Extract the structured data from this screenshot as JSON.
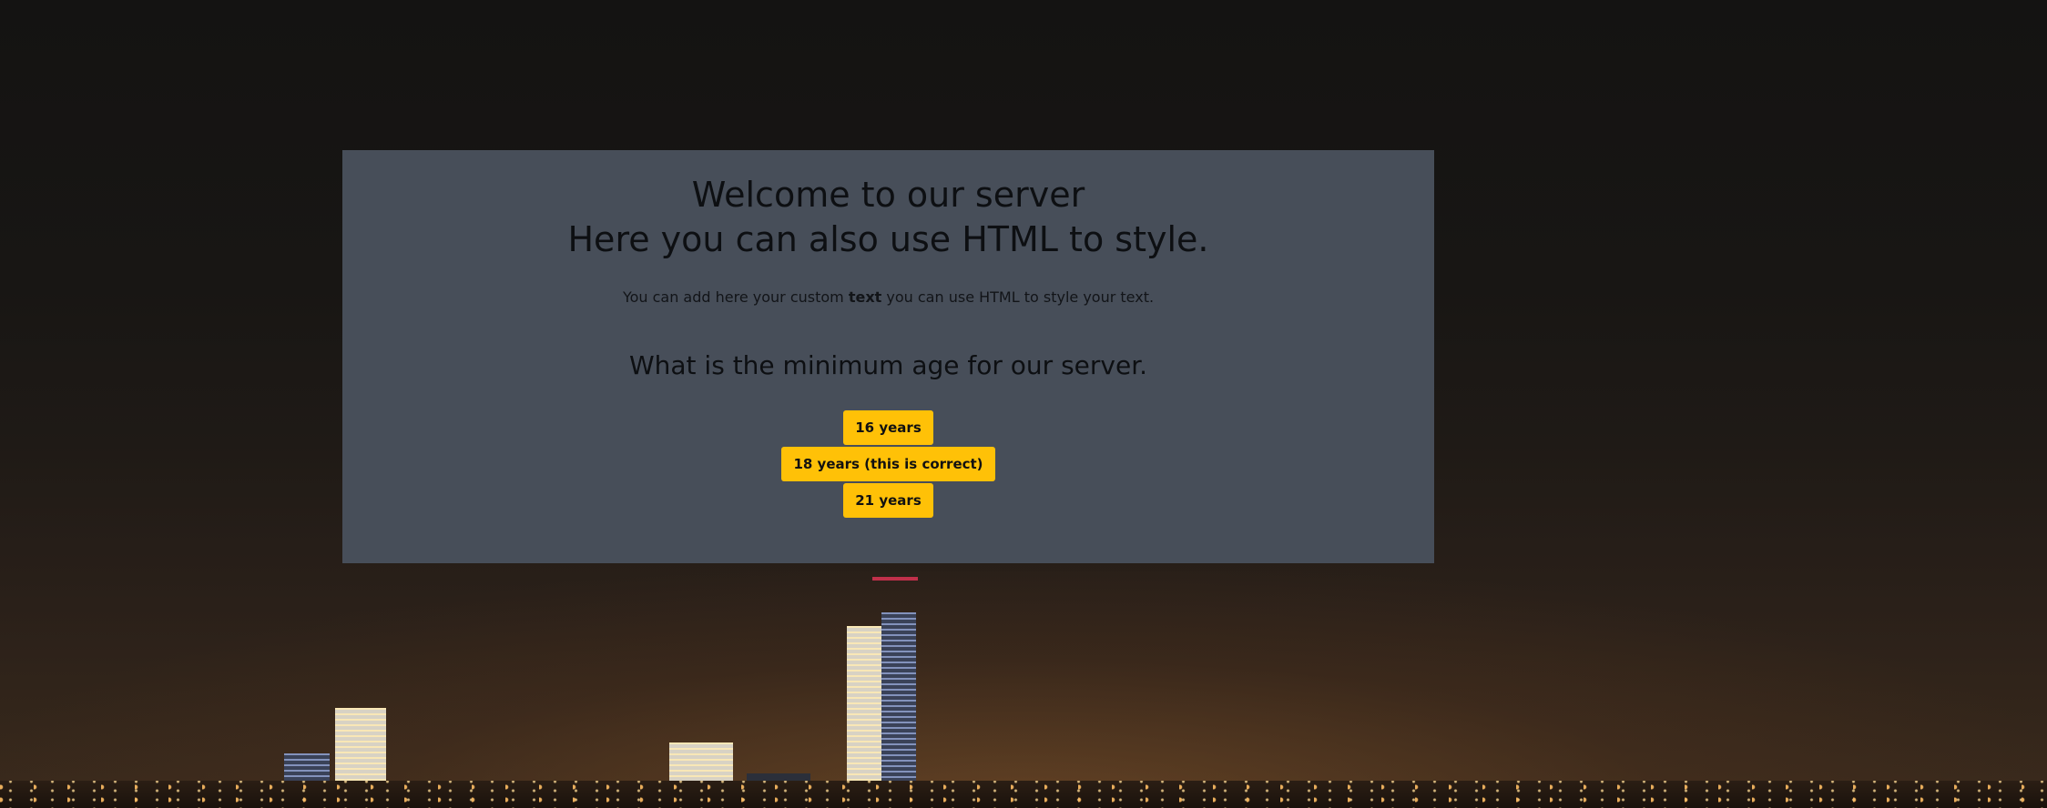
{
  "dialog": {
    "title_line1": "Welcome to our server",
    "title_line2": "Here you can also use HTML to style.",
    "intro": {
      "before": "You can add here your custom ",
      "bold": "text",
      "after": " you can use HTML to style your text."
    },
    "question": "What is the minimum age for our server.",
    "answers": [
      {
        "label": "16 years"
      },
      {
        "label": "18 years (this is correct)"
      },
      {
        "label": "21 years"
      }
    ]
  },
  "colors": {
    "dialog_background": "#474e59",
    "button_background": "#ffc107",
    "page_background": "#141312"
  }
}
